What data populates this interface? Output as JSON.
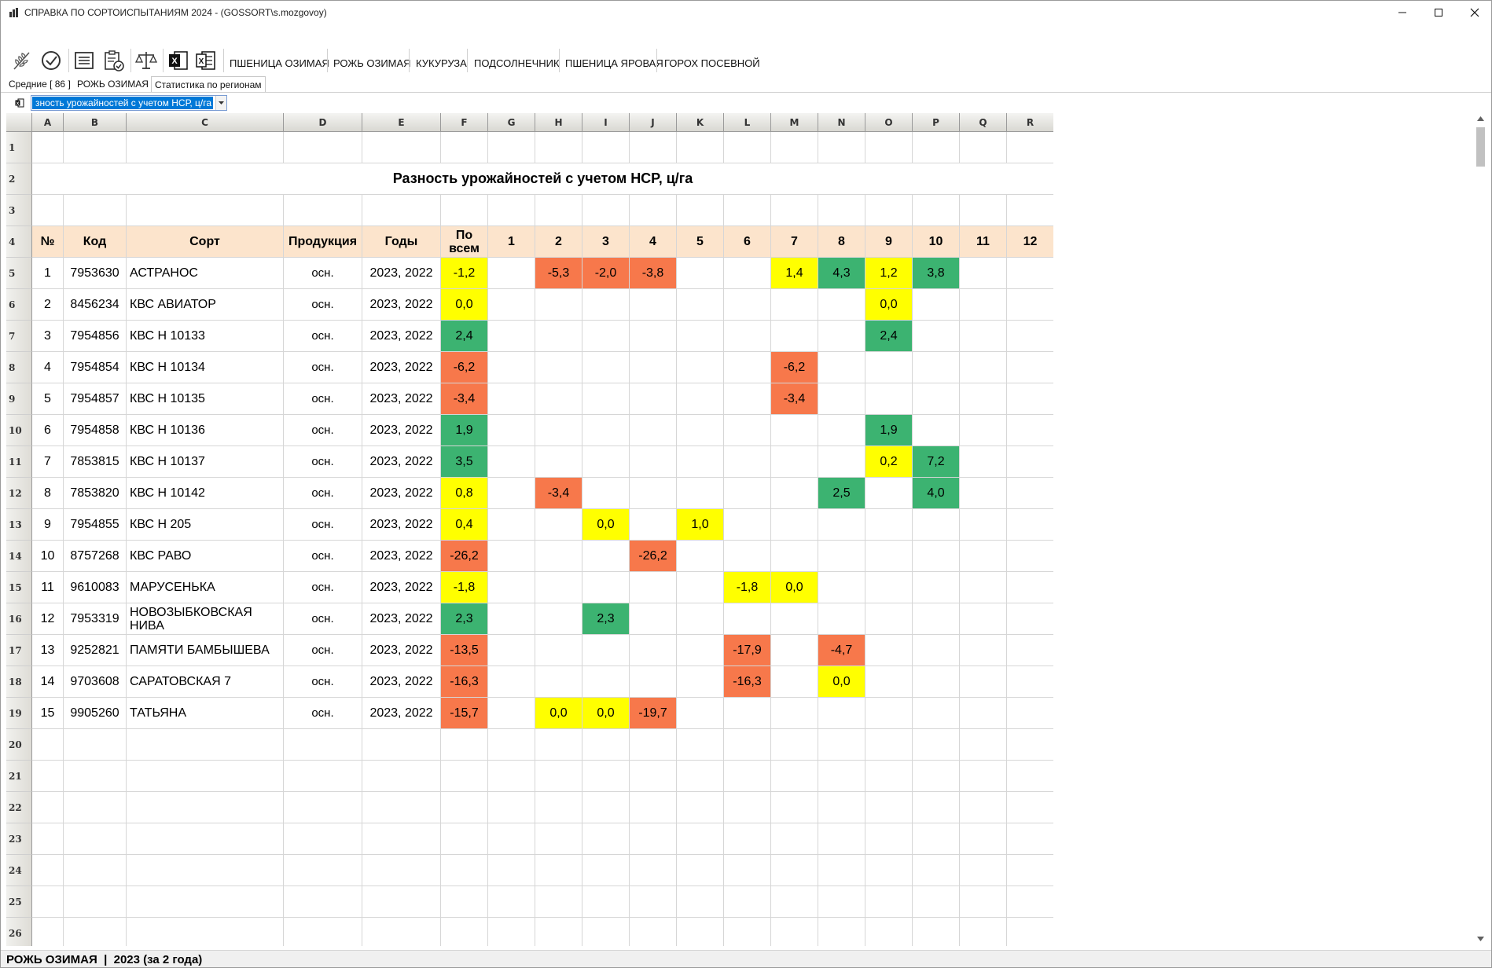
{
  "window": {
    "title": "СПРАВКА ПО СОРТОИСПЫТАНИЯМ 2024 - (GOSSORT\\s.mozgovoy)"
  },
  "toolbar": {
    "icons": [
      "sprout-icon",
      "check-circle-icon",
      "list-icon",
      "clipboard-check-icon",
      "scales-icon",
      "excel-icon",
      "excel-export-icon"
    ],
    "crops": [
      "ПШЕНИЦА ОЗИМАЯ",
      "РОЖЬ ОЗИМАЯ",
      "КУКУРУЗА",
      "ПОДСОЛНЕЧНИК",
      "ПШЕНИЦА ЯРОВАЯ",
      "ГОРОХ ПОСЕВНОЙ"
    ]
  },
  "tabs": [
    "Средние [ 86 ]",
    "РОЖЬ ОЗИМАЯ",
    "Статистика по регионам"
  ],
  "active_tab": 2,
  "report_select": {
    "value": "Разность урожайностей с учетом НСР, ц/га",
    "visible_text": "зность урожайностей с учетом НСР, ц/га"
  },
  "columns": [
    "A",
    "B",
    "C",
    "D",
    "E",
    "F",
    "G",
    "H",
    "I",
    "J",
    "K",
    "L",
    "M",
    "N",
    "O",
    "P",
    "Q",
    "R"
  ],
  "sheet_title": "Разность урожайностей с учетом НСР, ц/га",
  "header": [
    "№",
    "Код",
    "Сорт",
    "Продукция",
    "Годы",
    "По всем",
    "1",
    "2",
    "3",
    "4",
    "5",
    "6",
    "7",
    "8",
    "9",
    "10",
    "11",
    "12"
  ],
  "rows": [
    {
      "n": "1",
      "code": "7953630",
      "name": "АСТРАНОС",
      "prod": "осн.",
      "years": "2023, 2022",
      "all": "-1,2",
      "regions": [
        "",
        "-5,3",
        "-2,0",
        "-3,8",
        "",
        "",
        "1,4",
        "4,3",
        "1,2",
        "3,8",
        "",
        ""
      ]
    },
    {
      "n": "2",
      "code": "8456234",
      "name": "КВС АВИАТОР",
      "prod": "осн.",
      "years": "2023, 2022",
      "all": "0,0",
      "regions": [
        "",
        "",
        "",
        "",
        "",
        "",
        "",
        "",
        "0,0",
        "",
        "",
        ""
      ]
    },
    {
      "n": "3",
      "code": "7954856",
      "name": "КВС Н 10133",
      "prod": "осн.",
      "years": "2023, 2022",
      "all": "2,4",
      "regions": [
        "",
        "",
        "",
        "",
        "",
        "",
        "",
        "",
        "2,4",
        "",
        "",
        ""
      ]
    },
    {
      "n": "4",
      "code": "7954854",
      "name": "КВС Н 10134",
      "prod": "осн.",
      "years": "2023, 2022",
      "all": "-6,2",
      "regions": [
        "",
        "",
        "",
        "",
        "",
        "",
        "-6,2",
        "",
        "",
        "",
        "",
        ""
      ]
    },
    {
      "n": "5",
      "code": "7954857",
      "name": "КВС Н 10135",
      "prod": "осн.",
      "years": "2023, 2022",
      "all": "-3,4",
      "regions": [
        "",
        "",
        "",
        "",
        "",
        "",
        "-3,4",
        "",
        "",
        "",
        "",
        ""
      ]
    },
    {
      "n": "6",
      "code": "7954858",
      "name": "КВС Н 10136",
      "prod": "осн.",
      "years": "2023, 2022",
      "all": "1,9",
      "regions": [
        "",
        "",
        "",
        "",
        "",
        "",
        "",
        "",
        "1,9",
        "",
        "",
        ""
      ]
    },
    {
      "n": "7",
      "code": "7853815",
      "name": "КВС Н 10137",
      "prod": "осн.",
      "years": "2023, 2022",
      "all": "3,5",
      "regions": [
        "",
        "",
        "",
        "",
        "",
        "",
        "",
        "",
        "0,2",
        "7,2",
        "",
        ""
      ]
    },
    {
      "n": "8",
      "code": "7853820",
      "name": "КВС Н 10142",
      "prod": "осн.",
      "years": "2023, 2022",
      "all": "0,8",
      "regions": [
        "",
        "-3,4",
        "",
        "",
        "",
        "",
        "",
        "2,5",
        "",
        "4,0",
        "",
        ""
      ]
    },
    {
      "n": "9",
      "code": "7954855",
      "name": "КВС Н 205",
      "prod": "осн.",
      "years": "2023, 2022",
      "all": "0,4",
      "regions": [
        "",
        "",
        "0,0",
        "",
        "1,0",
        "",
        "",
        "",
        "",
        "",
        "",
        ""
      ]
    },
    {
      "n": "10",
      "code": "8757268",
      "name": "КВС РАВО",
      "prod": "осн.",
      "years": "2023, 2022",
      "all": "-26,2",
      "regions": [
        "",
        "",
        "",
        "-26,2",
        "",
        "",
        "",
        "",
        "",
        "",
        "",
        ""
      ]
    },
    {
      "n": "11",
      "code": "9610083",
      "name": "МАРУСЕНЬКА",
      "prod": "осн.",
      "years": "2023, 2022",
      "all": "-1,8",
      "regions": [
        "",
        "",
        "",
        "",
        "",
        "-1,8",
        "0,0",
        "",
        "",
        "",
        "",
        ""
      ]
    },
    {
      "n": "12",
      "code": "7953319",
      "name": "НОВОЗЫБКОВСКАЯ НИВА",
      "prod": "осн.",
      "years": "2023, 2022",
      "all": "2,3",
      "regions": [
        "",
        "",
        "2,3",
        "",
        "",
        "",
        "",
        "",
        "",
        "",
        "",
        ""
      ]
    },
    {
      "n": "13",
      "code": "9252821",
      "name": "ПАМЯТИ БАМБЫШЕВА",
      "prod": "осн.",
      "years": "2023, 2022",
      "all": "-13,5",
      "regions": [
        "",
        "",
        "",
        "",
        "",
        "-17,9",
        "",
        "-4,7",
        "",
        "",
        "",
        ""
      ]
    },
    {
      "n": "14",
      "code": "9703608",
      "name": "САРАТОВСКАЯ 7",
      "prod": "осн.",
      "years": "2023, 2022",
      "all": "-16,3",
      "regions": [
        "",
        "",
        "",
        "",
        "",
        "-16,3",
        "",
        "0,0",
        "",
        "",
        "",
        ""
      ]
    },
    {
      "n": "15",
      "code": "9905260",
      "name": "ТАТЬЯНА",
      "prod": "осн.",
      "years": "2023, 2022",
      "all": "-15,7",
      "regions": [
        "",
        "0,0",
        "0,0",
        "-19,7",
        "",
        "",
        "",
        "",
        "",
        "",
        "",
        ""
      ]
    }
  ],
  "cell_colors": {
    "positive": "#3cb371",
    "neutral": "#ffff00",
    "negative": "#f7784b",
    "header": "#fce4cc"
  },
  "statusbar": {
    "text": "РОЖЬ ОЗИМАЯ  |  2023 (за 2 года)"
  }
}
